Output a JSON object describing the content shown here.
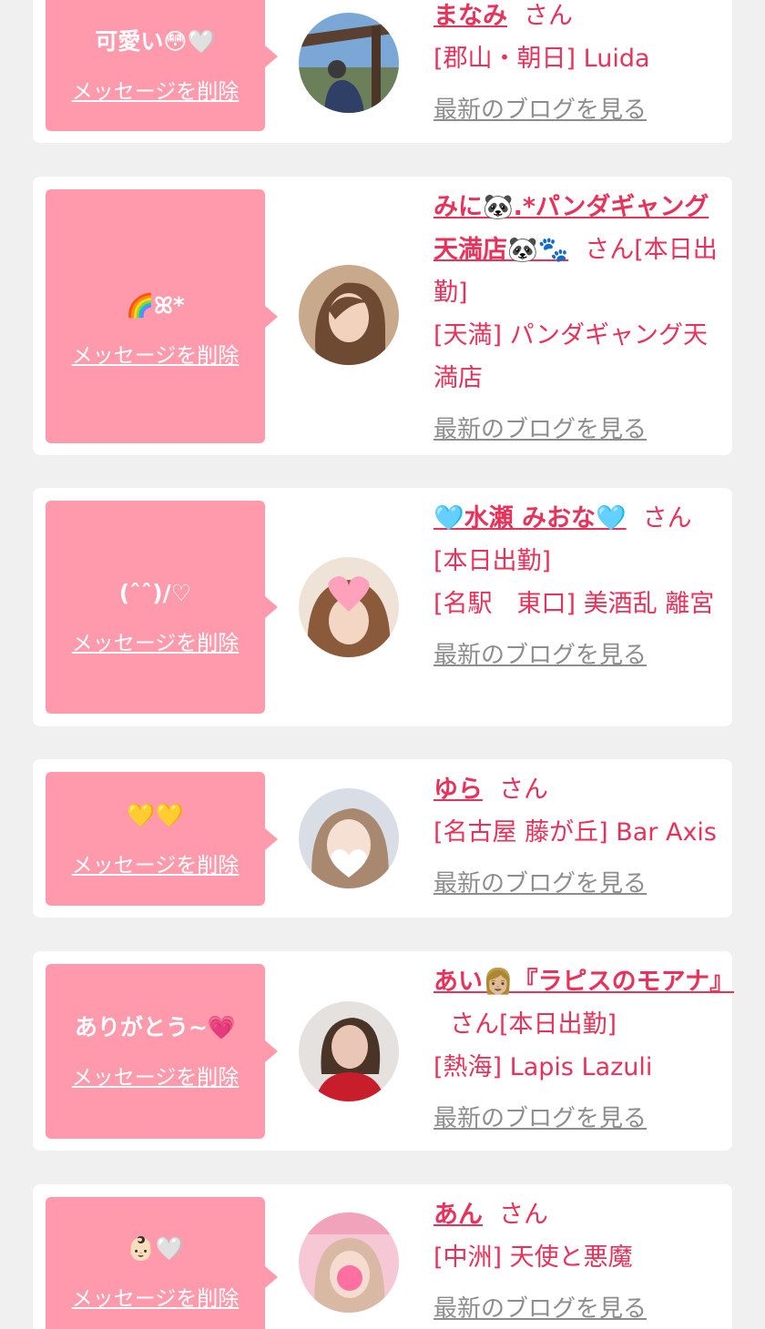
{
  "messages": [
    {
      "message": "可愛い😳🤍",
      "delete_label": "メッセージを削除",
      "name": "まなみ",
      "honorific": "さん",
      "status": "",
      "shop": "[郡山・朝日] Luida",
      "blog_label": "最新のブログを見る"
    },
    {
      "message": "🌈ꕤ*",
      "delete_label": "メッセージを削除",
      "name": "みに🐼.*パンダギャング天満店🐼🐾",
      "honorific": "さん",
      "status": "[本日出勤]",
      "shop": "[天満] パンダギャング天満店",
      "blog_label": "最新のブログを見る"
    },
    {
      "message": "(ˆˆ)/♡",
      "delete_label": "メッセージを削除",
      "name": "🩵水瀬 みおな🩵",
      "honorific": "さん",
      "status": "[本日出勤]",
      "shop": "[名駅　東口] 美酒乱 離宮",
      "blog_label": "最新のブログを見る"
    },
    {
      "message": "💛💛",
      "delete_label": "メッセージを削除",
      "name": "ゆら",
      "honorific": "さん",
      "status": "",
      "shop": "[名古屋 藤が丘] Bar Axis",
      "blog_label": "最新のブログを見る"
    },
    {
      "message": "ありがとう~💗",
      "delete_label": "メッセージを削除",
      "name": "あい👩🏼『ラピスのモアナ』",
      "honorific": "さん",
      "status": "[本日出勤]",
      "shop": "[熱海] Lapis Lazuli",
      "blog_label": "最新のブログを見る"
    },
    {
      "message": "👶🏻🤍",
      "delete_label": "メッセージを削除",
      "name": "あん",
      "honorific": "さん",
      "status": "",
      "shop": "[中洲] 天使と悪魔",
      "blog_label": "最新のブログを見る"
    }
  ],
  "colors": {
    "bubble": "#ff9aac",
    "accent": "#e8325a",
    "link_gray": "#8d8d8d",
    "page_bg": "#f0f0f0"
  }
}
